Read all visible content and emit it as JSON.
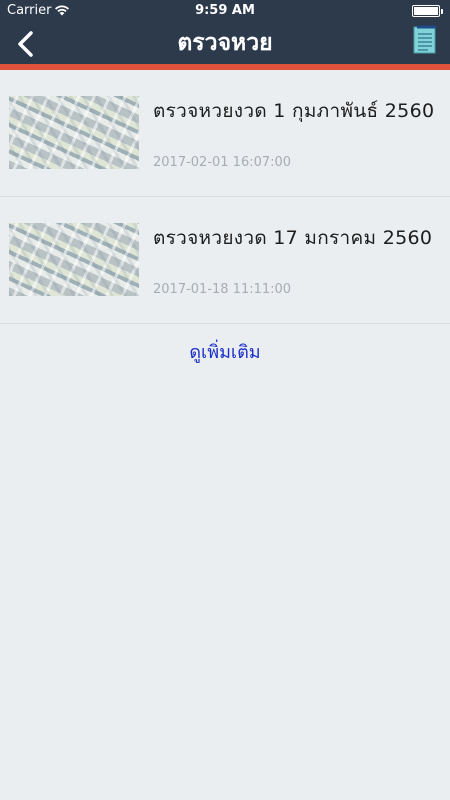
{
  "status_bar": {
    "carrier": "Carrier",
    "time": "9:59 AM"
  },
  "nav": {
    "title": "ตรวจหวย",
    "back_icon": "chevron-left-icon",
    "right_icon": "document-icon"
  },
  "items": [
    {
      "title": " ตรวจหวยงวด 1 กุมภาพันธ์ 2560",
      "date": "2017-02-01 16:07:00"
    },
    {
      "title": " ตรวจหวยงวด 17 มกราคม 2560",
      "date": "2017-01-18 11:11:00"
    }
  ],
  "more_label": "ดูเพิ่มเติม",
  "colors": {
    "header": "#2c3a4c",
    "accent": "#e0523a",
    "background": "#eaeef1",
    "link": "#1a2fc7"
  }
}
